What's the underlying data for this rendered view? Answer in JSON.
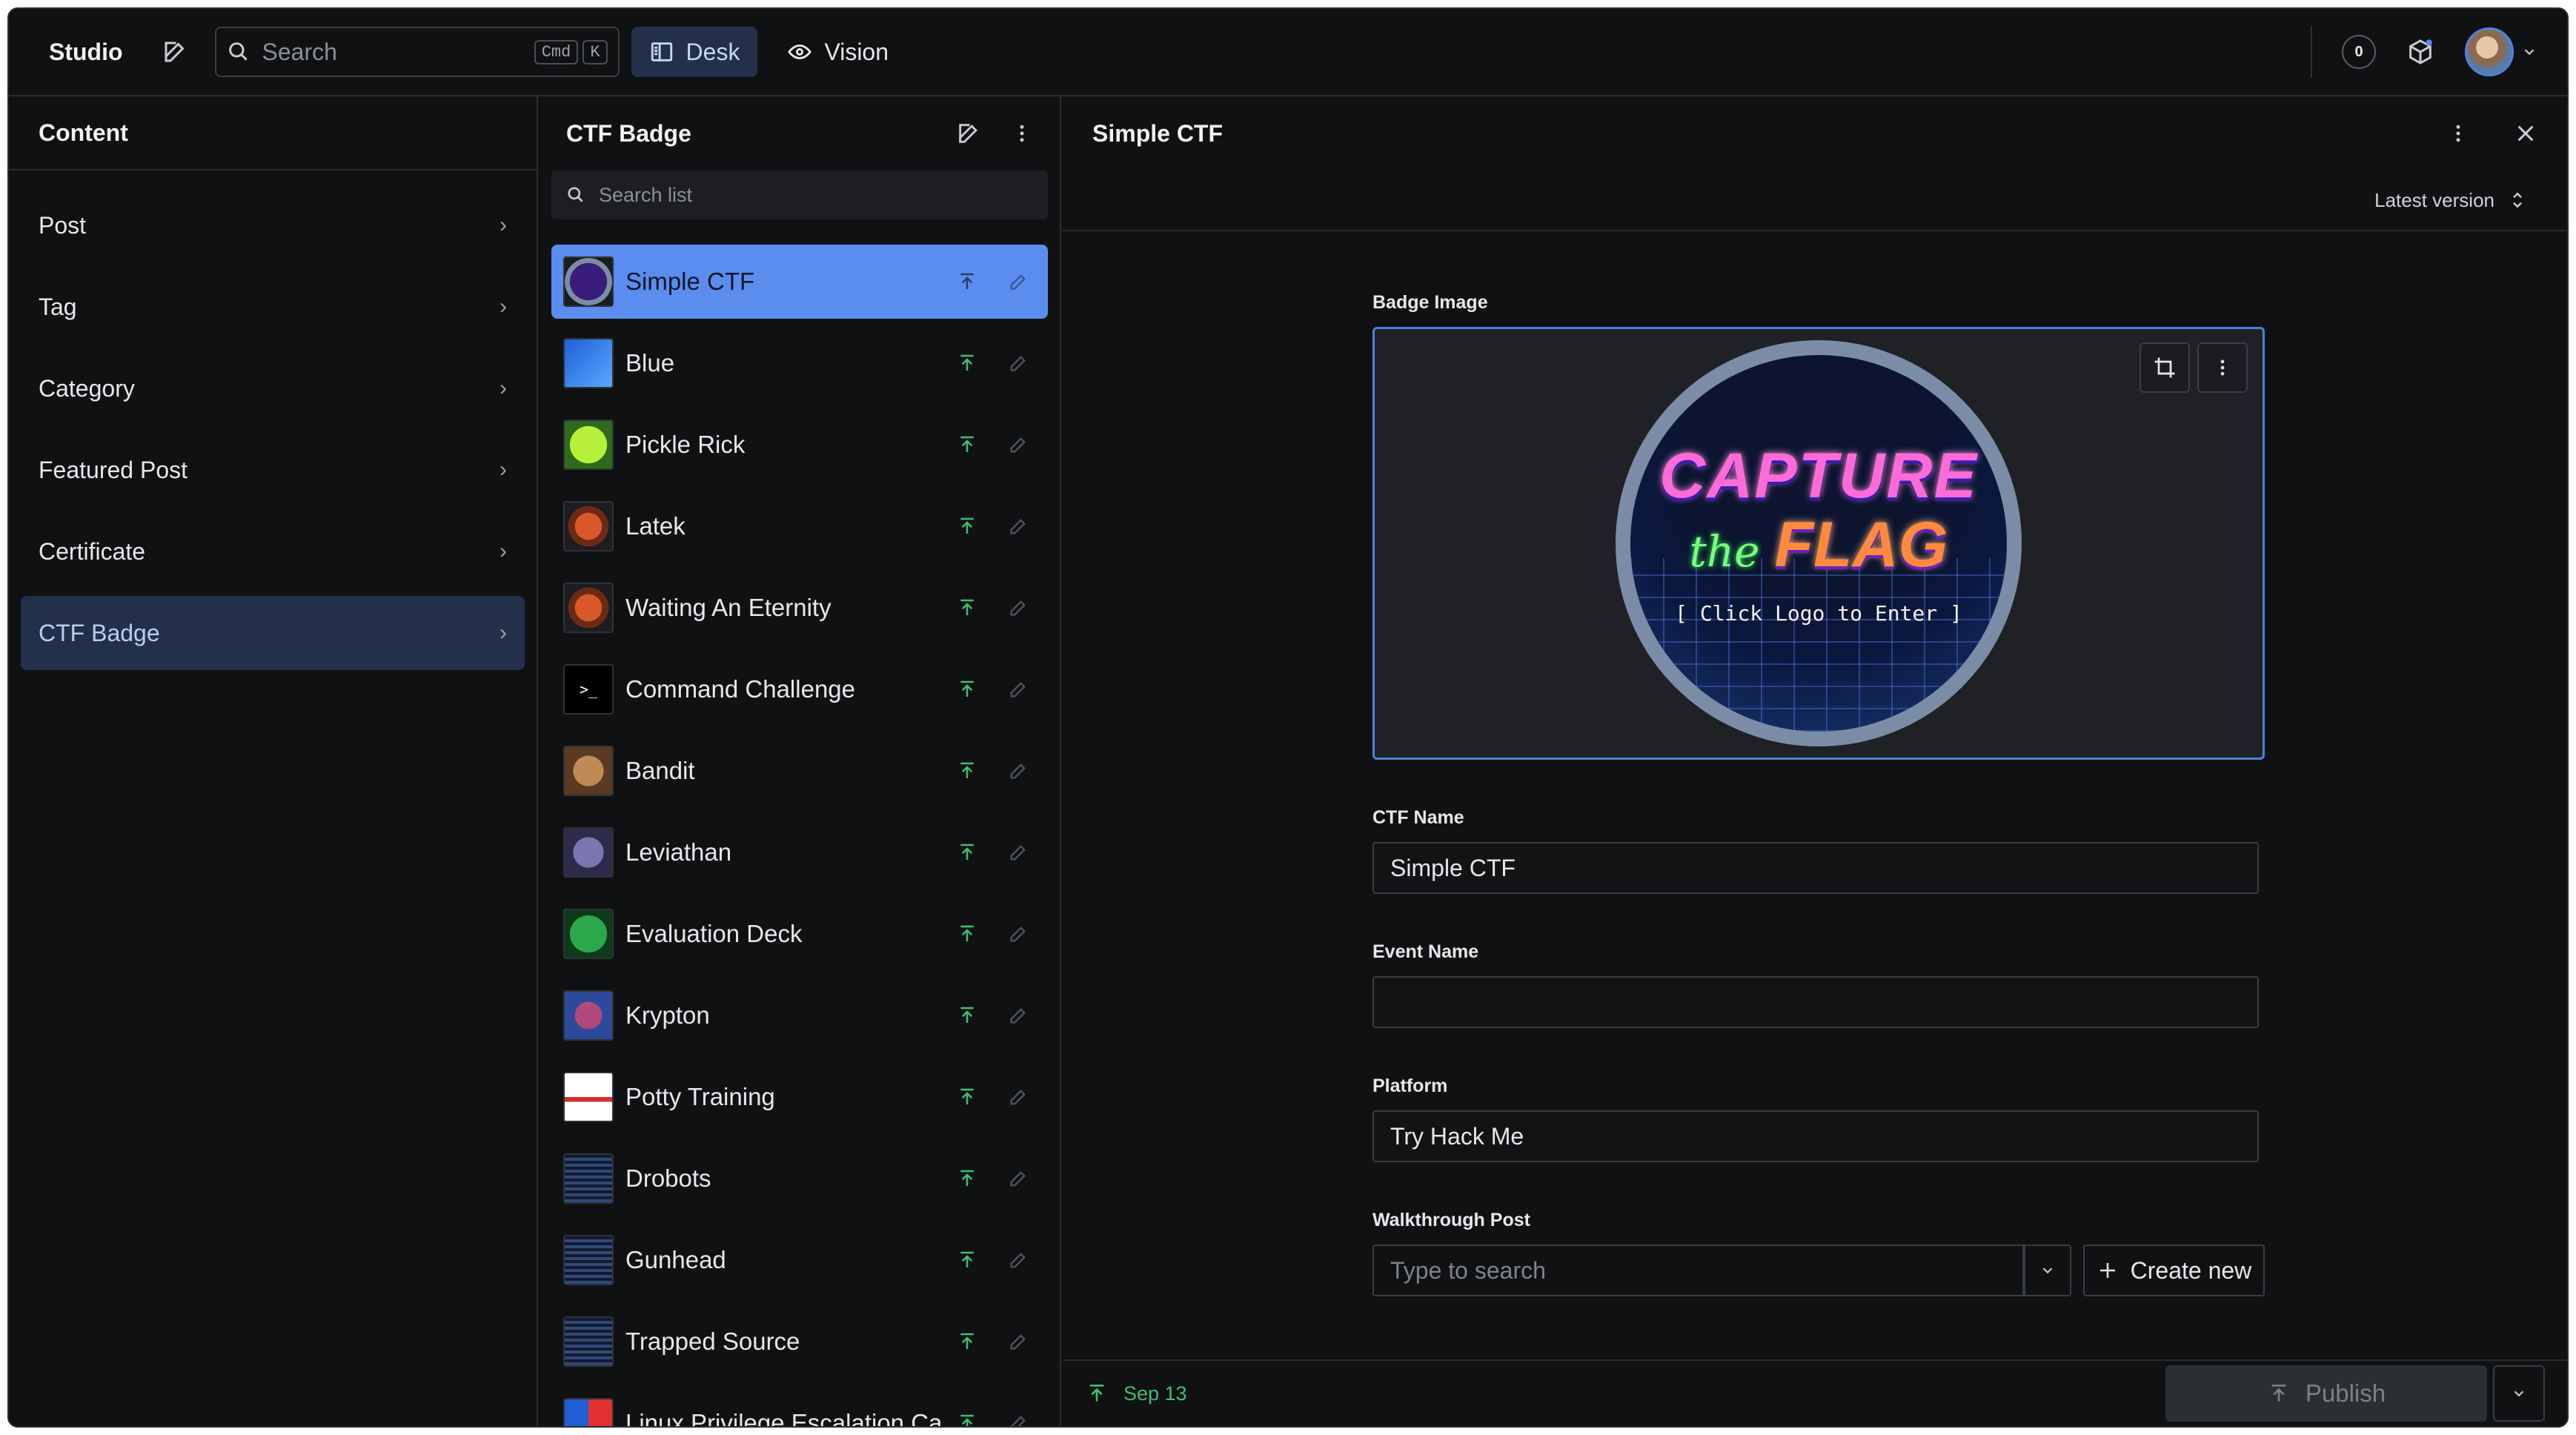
{
  "navbar": {
    "brand": "Studio",
    "search_placeholder": "Search",
    "kbd_cmd": "Cmd",
    "kbd_key": "K",
    "tools": [
      {
        "label": "Desk",
        "active": true,
        "icon": "desk-icon"
      },
      {
        "label": "Vision",
        "active": false,
        "icon": "eye-icon"
      }
    ],
    "notification_count": "0"
  },
  "content_pane": {
    "title": "Content",
    "items": [
      {
        "label": "Post"
      },
      {
        "label": "Tag"
      },
      {
        "label": "Category"
      },
      {
        "label": "Featured Post"
      },
      {
        "label": "Certificate"
      },
      {
        "label": "CTF Badge",
        "selected": true
      }
    ]
  },
  "list_pane": {
    "title": "CTF Badge",
    "search_placeholder": "Search list",
    "items": [
      {
        "title": "Simple CTF",
        "selected": true,
        "thumb_icon": "ctf-logo-thumb"
      },
      {
        "title": "Blue",
        "thumb_icon": "blue-cube-thumb"
      },
      {
        "title": "Pickle Rick",
        "thumb_icon": "pickle-rick-thumb"
      },
      {
        "title": "Latek",
        "thumb_icon": "monkey-thumb"
      },
      {
        "title": "Waiting An Eternity",
        "thumb_icon": "monkey-thumb"
      },
      {
        "title": "Command Challenge",
        "thumb_icon": "terminal-thumb"
      },
      {
        "title": "Bandit",
        "thumb_icon": "bandit-thumb"
      },
      {
        "title": "Leviathan",
        "thumb_icon": "leviathan-thumb"
      },
      {
        "title": "Evaluation Deck",
        "thumb_icon": "hack-thumb"
      },
      {
        "title": "Krypton",
        "thumb_icon": "krypton-thumb"
      },
      {
        "title": "Potty Training",
        "thumb_icon": "potty-thumb"
      },
      {
        "title": "Drobots",
        "thumb_icon": "cyber-apocalypse-thumb"
      },
      {
        "title": "Gunhead",
        "thumb_icon": "cyber-apocalypse-thumb"
      },
      {
        "title": "Trapped Source",
        "thumb_icon": "cyber-apocalypse-thumb"
      },
      {
        "title": "Linux Privilege Escalation Ca",
        "thumb_icon": "linux-thumb"
      }
    ]
  },
  "document": {
    "title": "Simple CTF",
    "version_label": "Latest version",
    "badge_image_label": "Badge Image",
    "logo_text": {
      "line1": "CAPTURE",
      "the": "the",
      "flag": "FLAG",
      "enter": "[ Click Logo to Enter ]"
    },
    "ctf_name_label": "CTF Name",
    "ctf_name_value": "Simple CTF",
    "event_name_label": "Event Name",
    "event_name_value": "",
    "platform_label": "Platform",
    "platform_value": "Try Hack Me",
    "walkthrough_label": "Walkthrough Post",
    "walkthrough_placeholder": "Type to search",
    "create_new_label": "Create new",
    "published_date": "Sep 13",
    "publish_label": "Publish"
  },
  "colors": {
    "accent": "#5b8def",
    "published_green": "#3fbf72",
    "background": "#101112"
  }
}
